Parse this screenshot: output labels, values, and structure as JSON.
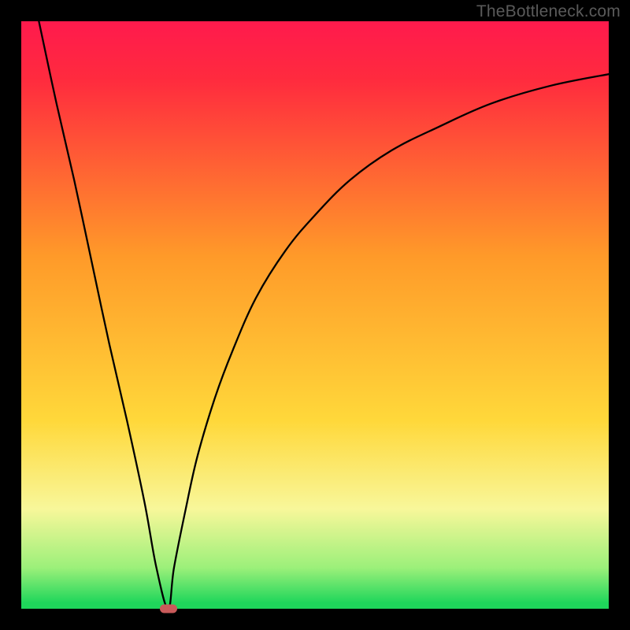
{
  "watermark": "TheBottleneck.com",
  "colors": {
    "top": "#ff1a4d",
    "red": "#ff2b3e",
    "orange": "#ff9a29",
    "yellow": "#ffd83a",
    "pale": "#f8f79a",
    "lgreen": "#9cf07a",
    "green": "#1fd65b",
    "curve": "#000000",
    "marker": "#c95a5a"
  },
  "chart_data": {
    "type": "line",
    "title": "",
    "xlabel": "",
    "ylabel": "",
    "xlim": [
      0,
      100
    ],
    "ylim": [
      0,
      100
    ],
    "series": [
      {
        "name": "left-branch",
        "x": [
          3,
          6,
          9,
          12,
          15,
          18,
          21,
          23,
          25
        ],
        "values": [
          100,
          86,
          73,
          59,
          45,
          32,
          18,
          7,
          0
        ]
      },
      {
        "name": "right-branch",
        "x": [
          25,
          26,
          28,
          30,
          33,
          36,
          40,
          45,
          50,
          56,
          63,
          71,
          80,
          90,
          100
        ],
        "values": [
          0,
          7,
          17,
          26,
          36,
          44,
          53,
          61,
          67,
          73,
          78,
          82,
          86,
          89,
          91
        ]
      }
    ],
    "annotations": [
      {
        "name": "min-marker",
        "x": 25,
        "y": 0
      }
    ]
  }
}
